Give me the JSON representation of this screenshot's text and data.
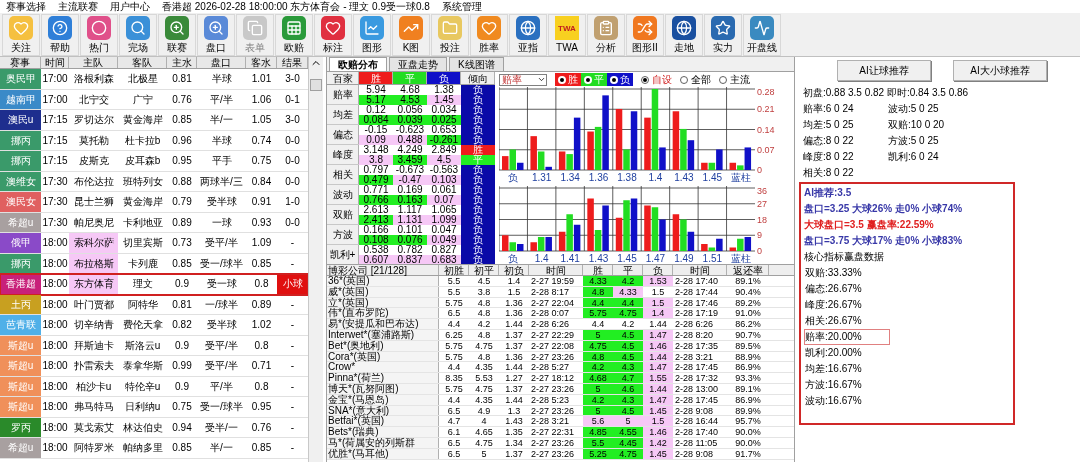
{
  "menu": [
    "赛事选择",
    "主流联赛",
    "用户中心",
    "香港超 2026-02-28 18:00:00 东方体育会 - 理文 0.9受一球0.8",
    "系统管理"
  ],
  "toolbar": [
    {
      "label": "关注",
      "disabled": false
    },
    {
      "label": "帮助",
      "disabled": false
    },
    {
      "label": "热门",
      "disabled": false
    },
    {
      "label": "完场",
      "disabled": false
    },
    {
      "label": "联赛",
      "disabled": false
    },
    {
      "label": "盘口",
      "disabled": false
    },
    {
      "label": "表单",
      "disabled": true
    },
    {
      "label": "欧赔",
      "disabled": false
    },
    {
      "label": "标注",
      "disabled": false
    },
    {
      "label": "图形",
      "disabled": false
    },
    {
      "label": "K图",
      "disabled": false
    },
    {
      "label": "投注",
      "disabled": false
    },
    {
      "label": "胜率",
      "disabled": false
    },
    {
      "label": "亚指",
      "disabled": false
    },
    {
      "label": "TWA",
      "disabled": false,
      "icon_text": "TWA"
    },
    {
      "label": "分析",
      "disabled": false
    },
    {
      "label": "图形II",
      "disabled": false
    },
    {
      "label": "走地",
      "disabled": false
    },
    {
      "label": "实力",
      "disabled": false
    },
    {
      "label": "开盘线",
      "disabled": false
    }
  ],
  "matches": {
    "columns": [
      "赛事",
      "时间",
      "主队",
      "客队",
      "主水",
      "盘口",
      "客水",
      "结果"
    ],
    "rows": [
      {
        "league": "奥民甲",
        "color": "#3a9a6a",
        "time": "17:00",
        "home": "洛根利森",
        "away": "北极星",
        "home_water": "0.81",
        "line": "半球",
        "away_water": "1.01",
        "result": "3-0",
        "home_highlight": false,
        "result_flag": false,
        "selected": false
      },
      {
        "league": "越南甲",
        "color": "#3a8ac8",
        "time": "17:00",
        "home": "北宁交",
        "away": "广宁",
        "home_water": "0.76",
        "line": "平/半",
        "away_water": "1.06",
        "result": "0-1",
        "home_highlight": false,
        "result_flag": false,
        "selected": false
      },
      {
        "league": "澳民u",
        "color": "#1e2e8e",
        "time": "17:15",
        "home": "罗切达尔",
        "away": "黄金海岸",
        "home_water": "0.85",
        "line": "半/一",
        "away_water": "1.05",
        "result": "3-0",
        "home_highlight": false,
        "result_flag": false,
        "selected": false
      },
      {
        "league": "挪丙",
        "color": "#3a9a6a",
        "time": "17:15",
        "home": "莫托勒",
        "away": "杜卡拉b",
        "home_water": "0.96",
        "line": "半球",
        "away_water": "0.74",
        "result": "0-0",
        "home_highlight": false,
        "result_flag": false,
        "selected": false
      },
      {
        "league": "挪丙",
        "color": "#3a9a6a",
        "time": "17:15",
        "home": "皮斯克",
        "away": "皮耳森b",
        "home_water": "0.95",
        "line": "平手",
        "away_water": "0.75",
        "result": "0-0",
        "home_highlight": false,
        "result_flag": false,
        "selected": false
      },
      {
        "league": "澳维女",
        "color": "#3a9a6a",
        "time": "17:30",
        "home": "布伦达拉",
        "away": "班特列女",
        "home_water": "0.88",
        "line": "两球半/三",
        "away_water": "0.84",
        "result": "0-0",
        "home_highlight": false,
        "result_flag": false,
        "selected": false
      },
      {
        "league": "澳民女",
        "color": "#e06060",
        "time": "17:30",
        "home": "昆士兰狮",
        "away": "黄金海岸",
        "home_water": "0.79",
        "line": "受半球",
        "away_water": "0.91",
        "result": "1-0",
        "home_highlight": false,
        "result_flag": false,
        "selected": false
      },
      {
        "league": "希超u",
        "color": "#a8a0a0",
        "time": "17:30",
        "home": "帕尼奥尼",
        "away": "卡利地亚",
        "home_water": "0.89",
        "line": "一球",
        "away_water": "0.93",
        "result": "0-0",
        "home_highlight": false,
        "result_flag": false,
        "selected": false
      },
      {
        "league": "俄甲",
        "color": "#8a4ac8",
        "time": "18:00",
        "home": "索科尔萨",
        "away": "切里宾斯",
        "home_water": "0.73",
        "line": "受平/半",
        "away_water": "1.09",
        "result": "-",
        "home_highlight": true,
        "result_flag": false,
        "selected": false
      },
      {
        "league": "挪丙",
        "color": "#3a9a6a",
        "time": "18:00",
        "home": "布拉格斯",
        "away": "卡列鹿",
        "home_water": "0.85",
        "line": "受一/球半",
        "away_water": "0.85",
        "result": "-",
        "home_highlight": true,
        "result_flag": false,
        "selected": false
      },
      {
        "league": "香港超",
        "color": "#c8207a",
        "time": "18:00",
        "home": "东方体育",
        "away": "理文",
        "home_water": "0.9",
        "line": "受一球",
        "away_water": "0.8",
        "result": "小球",
        "home_highlight": true,
        "result_flag": true,
        "selected": true
      },
      {
        "league": "土丙",
        "color": "#c8a020",
        "time": "18:00",
        "home": "叶门贾都",
        "away": "阿特华",
        "home_water": "0.81",
        "line": "一/球半",
        "away_water": "0.89",
        "result": "-",
        "home_highlight": false,
        "result_flag": false,
        "selected": false
      },
      {
        "league": "芭青联",
        "color": "#50b0e8",
        "time": "18:00",
        "home": "切辛纳青",
        "away": "费伦天拿",
        "home_water": "0.82",
        "line": "受半球",
        "away_water": "1.02",
        "result": "-",
        "home_highlight": false,
        "result_flag": false,
        "selected": false
      },
      {
        "league": "斯超u",
        "color": "#f0905a",
        "time": "18:00",
        "home": "拜斯迪卡",
        "away": "斯洛云u",
        "home_water": "0.9",
        "line": "受平/半",
        "away_water": "0.8",
        "result": "-",
        "home_highlight": false,
        "result_flag": false,
        "selected": false
      },
      {
        "league": "斯超u",
        "color": "#f0905a",
        "time": "18:00",
        "home": "扑雷索夫",
        "away": "泰拿华斯",
        "home_water": "0.99",
        "line": "受平/半",
        "away_water": "0.71",
        "result": "-",
        "home_highlight": false,
        "result_flag": false,
        "selected": false
      },
      {
        "league": "斯超u",
        "color": "#f0905a",
        "time": "18:00",
        "home": "柏沙卡u",
        "away": "特伦辛u",
        "home_water": "0.9",
        "line": "平/半",
        "away_water": "0.8",
        "result": "-",
        "home_highlight": false,
        "result_flag": false,
        "selected": false
      },
      {
        "league": "斯超u",
        "color": "#f0905a",
        "time": "18:00",
        "home": "弗马特马",
        "away": "日利纳u",
        "home_water": "0.75",
        "line": "受一/球半",
        "away_water": "0.95",
        "result": "-",
        "home_highlight": false,
        "result_flag": false,
        "selected": false
      },
      {
        "league": "罗丙",
        "color": "#2a8a2a",
        "time": "18:00",
        "home": "莫戈索艾",
        "away": "林达伯史",
        "home_water": "0.94",
        "line": "受半/一",
        "away_water": "0.76",
        "result": "-",
        "home_highlight": false,
        "result_flag": false,
        "selected": false
      },
      {
        "league": "希超u",
        "color": "#a8a0a0",
        "time": "18:00",
        "home": "阿特罗米",
        "away": "帕纳多里",
        "home_water": "0.85",
        "line": "半/一",
        "away_water": "0.85",
        "result": "-",
        "home_highlight": false,
        "result_flag": false,
        "selected": false
      }
    ]
  },
  "tabs": [
    {
      "label": "欧赔分布",
      "selected": true
    },
    {
      "label": "亚盘走势",
      "selected": false
    },
    {
      "label": "K线图谱",
      "selected": false
    }
  ],
  "stats": {
    "headers": [
      {
        "v": "百家",
        "color": "#f0f0f0"
      },
      {
        "v": "胜",
        "color": "#ee1c1c"
      },
      {
        "v": "平",
        "color": "#22dd22"
      },
      {
        "v": "负",
        "color": "#1010c8"
      },
      {
        "v": "倾向",
        "color": "#f0f0f0"
      }
    ],
    "rows": [
      {
        "label": "赔率",
        "lines": [
          [
            {
              "v": "5.94",
              "color": "#ffffff"
            },
            {
              "v": "4.68",
              "color": "#ffffff"
            },
            {
              "v": "1.38",
              "color": "#ffffff"
            },
            {
              "v": "负",
              "color": "#0a0aa8"
            }
          ],
          [
            {
              "v": "5.17",
              "color": "#22ee22"
            },
            {
              "v": "4.53",
              "color": "#22ee22"
            },
            {
              "v": "1.45",
              "color": "#f6c8f6"
            },
            {
              "v": "负",
              "color": "#0a0aa8"
            }
          ]
        ]
      },
      {
        "label": "均差",
        "lines": [
          [
            {
              "v": "0.12",
              "color": "#ffffff"
            },
            {
              "v": "0.056",
              "color": "#ffffff"
            },
            {
              "v": "0.034",
              "color": "#ffffff"
            },
            {
              "v": "负",
              "color": "#0a0aa8"
            }
          ],
          [
            {
              "v": "0.084",
              "color": "#22ee22"
            },
            {
              "v": "0.039",
              "color": "#22ee22"
            },
            {
              "v": "0.025",
              "color": "#22ee22"
            },
            {
              "v": "负",
              "color": "#0a0aa8"
            }
          ]
        ]
      },
      {
        "label": "偏态",
        "lines": [
          [
            {
              "v": "-0.15",
              "color": "#ffffff"
            },
            {
              "v": "-0.623",
              "color": "#ffffff"
            },
            {
              "v": "0.653",
              "color": "#ffffff"
            },
            {
              "v": "负",
              "color": "#0a0aa8"
            }
          ],
          [
            {
              "v": "0.09",
              "color": "#f6c8f6"
            },
            {
              "v": "0.488",
              "color": "#f6c8f6"
            },
            {
              "v": "-0.261",
              "color": "#22ee22"
            },
            {
              "v": "负",
              "color": "#0a0aa8"
            }
          ]
        ]
      },
      {
        "label": "峰度",
        "lines": [
          [
            {
              "v": "3.148",
              "color": "#ffffff"
            },
            {
              "v": "4.249",
              "color": "#ffffff"
            },
            {
              "v": "2.849",
              "color": "#ffffff"
            },
            {
              "v": "胜",
              "color": "#ee1c1c"
            }
          ],
          [
            {
              "v": "3.8",
              "color": "#f6c8f6"
            },
            {
              "v": "3.459",
              "color": "#22ee22"
            },
            {
              "v": "4.5",
              "color": "#f6c8f6"
            },
            {
              "v": "平",
              "color": "#22ee22"
            }
          ]
        ]
      },
      {
        "label": "相关",
        "lines": [
          [
            {
              "v": "0.797",
              "color": "#ffffff"
            },
            {
              "v": "-0.673",
              "color": "#ffffff"
            },
            {
              "v": "-0.563",
              "color": "#ffffff"
            },
            {
              "v": "负",
              "color": "#0a0aa8"
            }
          ],
          [
            {
              "v": "0.479",
              "color": "#22ee22"
            },
            {
              "v": "-0.47",
              "color": "#f6c8f6"
            },
            {
              "v": "0.103",
              "color": "#f6c8f6"
            },
            {
              "v": "负",
              "color": "#0a0aa8"
            }
          ]
        ]
      },
      {
        "label": "波动",
        "lines": [
          [
            {
              "v": "0.771",
              "color": "#ffffff"
            },
            {
              "v": "0.169",
              "color": "#ffffff"
            },
            {
              "v": "0.061",
              "color": "#ffffff"
            },
            {
              "v": "负",
              "color": "#0a0aa8"
            }
          ],
          [
            {
              "v": "0.766",
              "color": "#22ee22"
            },
            {
              "v": "0.163",
              "color": "#22ee22"
            },
            {
              "v": "0.07",
              "color": "#f6c8f6"
            },
            {
              "v": "负",
              "color": "#0a0aa8"
            }
          ]
        ]
      },
      {
        "label": "双赔",
        "lines": [
          [
            {
              "v": "2.613",
              "color": "#ffffff"
            },
            {
              "v": "1.117",
              "color": "#ffffff"
            },
            {
              "v": "1.065",
              "color": "#ffffff"
            },
            {
              "v": "负",
              "color": "#0a0aa8"
            }
          ],
          [
            {
              "v": "2.413",
              "color": "#22ee22"
            },
            {
              "v": "1.131",
              "color": "#f6c8f6"
            },
            {
              "v": "1.099",
              "color": "#f6c8f6"
            },
            {
              "v": "负",
              "color": "#0a0aa8"
            }
          ]
        ]
      },
      {
        "label": "方波",
        "lines": [
          [
            {
              "v": "0.166",
              "color": "#ffffff"
            },
            {
              "v": "0.101",
              "color": "#ffffff"
            },
            {
              "v": "0.047",
              "color": "#ffffff"
            },
            {
              "v": "负",
              "color": "#0a0aa8"
            }
          ],
          [
            {
              "v": "0.108",
              "color": "#22ee22"
            },
            {
              "v": "0.076",
              "color": "#22ee22"
            },
            {
              "v": "0.049",
              "color": "#f6c8f6"
            },
            {
              "v": "负",
              "color": "#0a0aa8"
            }
          ]
        ]
      },
      {
        "label": "凯利+",
        "lines": [
          [
            {
              "v": "0.538",
              "color": "#ffffff"
            },
            {
              "v": "0.782",
              "color": "#ffffff"
            },
            {
              "v": "0.827",
              "color": "#ffffff"
            },
            {
              "v": "负",
              "color": "#0a0aa8"
            }
          ],
          [
            {
              "v": "0.607",
              "color": "#f6c8f6"
            },
            {
              "v": "0.837",
              "color": "#f6c8f6"
            },
            {
              "v": "0.683",
              "color": "#f6c8f6"
            },
            {
              "v": "负",
              "color": "#0a0aa8"
            }
          ]
        ]
      }
    ]
  },
  "chart_controls": {
    "dropdown": {
      "value": "赔率"
    },
    "series_toggles": [
      {
        "checked": true
      },
      {
        "checked": true
      },
      {
        "checked": true
      }
    ],
    "radios": [
      {
        "label": "自设",
        "selected": true
      },
      {
        "label": "全部",
        "selected": false
      },
      {
        "label": "主流",
        "selected": false
      }
    ]
  },
  "charts": [
    {
      "chart_data": {
        "type": "bar",
        "grid": true,
        "categories": [
          "负",
          "1.31",
          "1.34",
          "1.36",
          "1.38",
          "1.4",
          "1.43",
          "1.45",
          "蓝柱"
        ],
        "ylim": [
          0,
          0.28
        ],
        "yticks": [
          0,
          0.07,
          0.14,
          0.21,
          0.28
        ],
        "series": [
          {
            "name": "胜",
            "color": "#ee1c1c",
            "values": [
              0.048,
              0.117,
              0.064,
              0.133,
              0.211,
              0.181,
              0.203,
              0.025,
              0.025
            ]
          },
          {
            "name": "平",
            "color": "#22dd22",
            "values": [
              0.071,
              0.064,
              0.055,
              0.149,
              0.071,
              0.28,
              0.142,
              0.025,
              0.016
            ]
          },
          {
            "name": "负",
            "color": "#1010c8",
            "values": [
              0.025,
              0.011,
              0.181,
              0.258,
              0.203,
              0.078,
              0.103,
              0.071,
              0.078
            ]
          }
        ]
      }
    },
    {
      "chart_data": {
        "type": "bar",
        "grid": true,
        "categories": [
          "负",
          "1.4",
          "1.41",
          "1.43",
          "1.45",
          "1.47",
          "1.49",
          "1.51",
          "蓝柱"
        ],
        "ylim": [
          0,
          36
        ],
        "yticks": [
          0,
          9,
          18,
          27,
          36
        ],
        "series": [
          {
            "color": "#ee1c1c",
            "values": [
              9,
              5,
              11,
              30,
              19,
              26,
              21,
              4,
              2
            ]
          },
          {
            "color": "#22dd22",
            "values": [
              5,
              8,
              21,
              12,
              29,
              25,
              18,
              2,
              7
            ]
          },
          {
            "color": "#1010c8",
            "values": [
              4,
              8,
              15,
              26,
              30,
              18,
              11,
              7,
              8
            ]
          }
        ]
      }
    }
  ],
  "bookmakers": {
    "columns": [
      "博彩公司 [21/128]",
      "初胜",
      "初平",
      "初负",
      "时间",
      "胜",
      "平",
      "负",
      "时间",
      "返还率"
    ],
    "rows": [
      {
        "name": "36*(英国)",
        "init": [
          "5.5",
          "4.5",
          "1.4"
        ],
        "init_time": "2-27 19:59",
        "now": [
          {
            "v": "4.33",
            "color": "#22ee22"
          },
          {
            "v": "4.2",
            "color": "#22ee22"
          },
          {
            "v": "1.53",
            "color": "#f6c8f6"
          }
        ],
        "time": "2-28 17:40",
        "return": "89.1%"
      },
      {
        "name": "威*(英国)",
        "init": [
          "5.5",
          "3.8",
          "1.5"
        ],
        "init_time": "2-28 8:17",
        "now": [
          {
            "v": "4.8",
            "color": "#22ee22"
          },
          {
            "v": "4.33",
            "color": "#f6c8f6"
          },
          {
            "v": "1.5",
            "color": "#ffffff"
          }
        ],
        "time": "2-28 17:44",
        "return": "90.4%"
      },
      {
        "name": "立*(英国)",
        "init": [
          "5.75",
          "4.8",
          "1.36"
        ],
        "init_time": "2-27 22:04",
        "now": [
          {
            "v": "4.4",
            "color": "#22ee22"
          },
          {
            "v": "4.4",
            "color": "#22ee22"
          },
          {
            "v": "1.5",
            "color": "#f6c8f6"
          }
        ],
        "time": "2-28 17:46",
        "return": "89.2%"
      },
      {
        "name": "伟*(直布罗陀)",
        "init": [
          "6.5",
          "4.8",
          "1.36"
        ],
        "init_time": "2-28 0:07",
        "now": [
          {
            "v": "5.75",
            "color": "#22ee22"
          },
          {
            "v": "4.75",
            "color": "#22ee22"
          },
          {
            "v": "1.4",
            "color": "#f6c8f6"
          }
        ],
        "time": "2-28 17:19",
        "return": "91.0%"
      },
      {
        "name": "易*(安提瓜和巴布达)",
        "init": [
          "4.4",
          "4.2",
          "1.44"
        ],
        "init_time": "2-28 6:26",
        "now": [
          {
            "v": "4.4",
            "color": "#ffffff"
          },
          {
            "v": "4.2",
            "color": "#ffffff"
          },
          {
            "v": "1.44",
            "color": "#ffffff"
          }
        ],
        "time": "2-28 6:26",
        "return": "86.2%"
      },
      {
        "name": "Interwet*(塞浦路斯)",
        "init": [
          "6.25",
          "4.8",
          "1.37"
        ],
        "init_time": "2-27 22:29",
        "now": [
          {
            "v": "5",
            "color": "#22ee22"
          },
          {
            "v": "4.5",
            "color": "#22ee22"
          },
          {
            "v": "1.47",
            "color": "#f6c8f6"
          }
        ],
        "time": "2-28 8:20",
        "return": "90.7%"
      },
      {
        "name": "Bet*(奥地利)",
        "init": [
          "5.75",
          "4.75",
          "1.37"
        ],
        "init_time": "2-27 22:08",
        "now": [
          {
            "v": "4.75",
            "color": "#22ee22"
          },
          {
            "v": "4.5",
            "color": "#22ee22"
          },
          {
            "v": "1.46",
            "color": "#f6c8f6"
          }
        ],
        "time": "2-28 17:35",
        "return": "89.5%"
      },
      {
        "name": "Cora*(英国)",
        "init": [
          "5.75",
          "4.8",
          "1.36"
        ],
        "init_time": "2-27 23:26",
        "now": [
          {
            "v": "4.8",
            "color": "#22ee22"
          },
          {
            "v": "4.5",
            "color": "#22ee22"
          },
          {
            "v": "1.44",
            "color": "#f6c8f6"
          }
        ],
        "time": "2-28 3:21",
        "return": "88.9%"
      },
      {
        "name": "Crow*",
        "init": [
          "4.4",
          "4.35",
          "1.44"
        ],
        "init_time": "2-28 5:27",
        "now": [
          {
            "v": "4.2",
            "color": "#22ee22"
          },
          {
            "v": "4.3",
            "color": "#22ee22"
          },
          {
            "v": "1.47",
            "color": "#f6c8f6"
          }
        ],
        "time": "2-28 17:45",
        "return": "86.9%"
      },
      {
        "name": "Pinna*(荷兰)",
        "init": [
          "8.35",
          "5.53",
          "1.27"
        ],
        "init_time": "2-27 18:12",
        "now": [
          {
            "v": "4.68",
            "color": "#22ee22"
          },
          {
            "v": "4.7",
            "color": "#22ee22"
          },
          {
            "v": "1.55",
            "color": "#f6c8f6"
          }
        ],
        "time": "2-28 17:32",
        "return": "93.3%"
      },
      {
        "name": "博天*(瓦努阿图)",
        "init": [
          "5.75",
          "4.75",
          "1.37"
        ],
        "init_time": "2-27 23:26",
        "now": [
          {
            "v": "5",
            "color": "#22ee22"
          },
          {
            "v": "4.6",
            "color": "#22ee22"
          },
          {
            "v": "1.44",
            "color": "#f6c8f6"
          }
        ],
        "time": "2-28 13:00",
        "return": "89.1%"
      },
      {
        "name": "金宝*(马恩岛)",
        "init": [
          "4.4",
          "4.35",
          "1.44"
        ],
        "init_time": "2-28 5:23",
        "now": [
          {
            "v": "4.2",
            "color": "#22ee22"
          },
          {
            "v": "4.3",
            "color": "#22ee22"
          },
          {
            "v": "1.47",
            "color": "#f6c8f6"
          }
        ],
        "time": "2-28 17:45",
        "return": "86.9%"
      },
      {
        "name": "SNA*(意大利)",
        "init": [
          "6.5",
          "4.9",
          "1.3"
        ],
        "init_time": "2-27 23:26",
        "now": [
          {
            "v": "5",
            "color": "#22ee22"
          },
          {
            "v": "4.5",
            "color": "#22ee22"
          },
          {
            "v": "1.45",
            "color": "#f6c8f6"
          }
        ],
        "time": "2-28 9:08",
        "return": "89.9%"
      },
      {
        "name": "Betfai*(英国)",
        "init": [
          "4.7",
          "4",
          "1.43"
        ],
        "init_time": "2-28 3:21",
        "now": [
          {
            "v": "5.6",
            "color": "#f6c8f6"
          },
          {
            "v": "5",
            "color": "#f6c8f6"
          },
          {
            "v": "1.5",
            "color": "#f6c8f6"
          }
        ],
        "time": "2-28 16:44",
        "return": "95.7%"
      },
      {
        "name": "Bets*(瑞典)",
        "init": [
          "6.1",
          "4.65",
          "1.35"
        ],
        "init_time": "2-27 22:31",
        "now": [
          {
            "v": "4.85",
            "color": "#22ee22"
          },
          {
            "v": "4.55",
            "color": "#22ee22"
          },
          {
            "v": "1.46",
            "color": "#f6c8f6"
          }
        ],
        "time": "2-28 17:40",
        "return": "90.0%"
      },
      {
        "name": "马*(荷属安的列斯群",
        "init": [
          "6.5",
          "4.75",
          "1.34"
        ],
        "init_time": "2-27 23:26",
        "now": [
          {
            "v": "5.5",
            "color": "#22ee22"
          },
          {
            "v": "4.45",
            "color": "#22ee22"
          },
          {
            "v": "1.42",
            "color": "#f6c8f6"
          }
        ],
        "time": "2-28 11:05",
        "return": "90.0%"
      },
      {
        "name": "优胜*(马耳他)",
        "init": [
          "6.5",
          "5",
          "1.37"
        ],
        "init_time": "2-27 23:26",
        "now": [
          {
            "v": "5.25",
            "color": "#22ee22"
          },
          {
            "v": "4.75",
            "color": "#22ee22"
          },
          {
            "v": "1.45",
            "color": "#f6c8f6"
          }
        ],
        "time": "2-28 9:08",
        "return": "91.7%"
      }
    ]
  },
  "ai_panel": {
    "buttons": [
      "AI让球推荐",
      "AI大小球推荐"
    ],
    "opening": "初盘:0.88 3.5 0.82 即时:0.84 3.5 0.86",
    "indicator_counts": [
      "赔率:6 0 24",
      "波动:5 0 25",
      "均差:5 0 25",
      "双赔:10 0 20",
      "偏态:8 0 22",
      "方波:5 0 25",
      "峰度:8 0 22",
      "凯利:6 0 24",
      "相关:8 0 22"
    ],
    "recommendation": [
      {
        "kind": "blue",
        "text": "AI推荐:3.5"
      },
      {
        "kind": "blue",
        "text": "盘口=3.25 大球26% 走0% 小球74%"
      },
      {
        "kind": "red",
        "text": "大球盘口=3.5 赢盘率:22.59%"
      },
      {
        "kind": "blue",
        "text": "盘口=3.75 大球17% 走0% 小球83%"
      },
      {
        "kind": "plain",
        "text": "核心指标赢盘数据"
      }
    ],
    "core_stats": [
      {
        "text": "双赔:33.33%",
        "highlighted": false
      },
      {
        "text": "偏态:26.67%",
        "highlighted": false
      },
      {
        "text": "峰度:26.67%",
        "highlighted": false
      },
      {
        "text": "相关:26.67%",
        "highlighted": false
      },
      {
        "text": "赔率:20.00%",
        "highlighted": true
      },
      {
        "text": "凯利:20.00%",
        "highlighted": false
      },
      {
        "text": "均差:16.67%",
        "highlighted": false
      },
      {
        "text": "方波:16.67%",
        "highlighted": false
      },
      {
        "text": "波动:16.67%",
        "highlighted": false
      }
    ]
  }
}
